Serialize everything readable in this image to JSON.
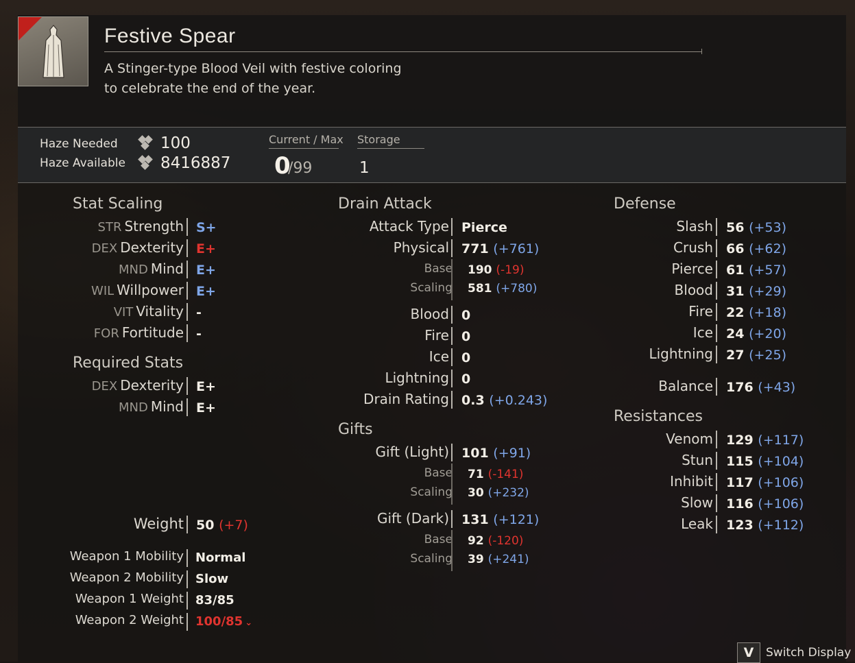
{
  "item": {
    "name": "Festive Spear",
    "description": "A Stinger-type Blood Veil with festive coloring\nto celebrate the end of the year."
  },
  "haze": {
    "needed_label": "Haze Needed",
    "needed_value": "100",
    "available_label": "Haze Available",
    "available_value": "8416887",
    "current_max_label": "Current / Max",
    "current": "0",
    "max": "/99",
    "storage_label": "Storage",
    "storage": "1"
  },
  "stat_scaling": {
    "title": "Stat Scaling",
    "rows": [
      {
        "abbr": "STR",
        "name": "Strength",
        "grade": "S+",
        "color": "#7fa6e8"
      },
      {
        "abbr": "DEX",
        "name": "Dexterity",
        "grade": "E+",
        "color": "#e0342f"
      },
      {
        "abbr": "MND",
        "name": "Mind",
        "grade": "E+",
        "color": "#7fa6e8"
      },
      {
        "abbr": "WIL",
        "name": "Willpower",
        "grade": "E+",
        "color": "#7fa6e8"
      },
      {
        "abbr": "VIT",
        "name": "Vitality",
        "grade": "-",
        "color": "#f2eee6"
      },
      {
        "abbr": "FOR",
        "name": "Fortitude",
        "grade": "-",
        "color": "#f2eee6"
      }
    ]
  },
  "required_stats": {
    "title": "Required Stats",
    "rows": [
      {
        "abbr": "DEX",
        "name": "Dexterity",
        "grade": "E+"
      },
      {
        "abbr": "MND",
        "name": "Mind",
        "grade": "E+"
      }
    ]
  },
  "weight": {
    "label": "Weight",
    "value": "50",
    "delta": "(+7)",
    "w1_mobility_label": "Weapon 1 Mobility",
    "w1_mobility": "Normal",
    "w2_mobility_label": "Weapon 2 Mobility",
    "w2_mobility": "Slow",
    "w1_weight_label": "Weapon 1 Weight",
    "w1_weight": "83/85",
    "w2_weight_label": "Weapon 2 Weight",
    "w2_weight": "100/85"
  },
  "drain_attack": {
    "title": "Drain Attack",
    "attack_type_label": "Attack Type",
    "attack_type": "Pierce",
    "physical_label": "Physical",
    "physical": "771",
    "physical_delta": "(+761)",
    "base_label": "Base",
    "base": "190",
    "base_delta": "(-19)",
    "scaling_label": "Scaling",
    "scaling": "581",
    "scaling_delta": "(+780)",
    "blood_label": "Blood",
    "blood": "0",
    "fire_label": "Fire",
    "fire": "0",
    "ice_label": "Ice",
    "ice": "0",
    "lightning_label": "Lightning",
    "lightning": "0",
    "drain_rating_label": "Drain Rating",
    "drain_rating": "0.3",
    "drain_rating_delta": "(+0.243)"
  },
  "gifts": {
    "title": "Gifts",
    "light_label": "Gift (Light)",
    "light": "101",
    "light_delta": "(+91)",
    "light_base_label": "Base",
    "light_base": "71",
    "light_base_delta": "(-141)",
    "light_scaling_label": "Scaling",
    "light_scaling": "30",
    "light_scaling_delta": "(+232)",
    "dark_label": "Gift (Dark)",
    "dark": "131",
    "dark_delta": "(+121)",
    "dark_base_label": "Base",
    "dark_base": "92",
    "dark_base_delta": "(-120)",
    "dark_scaling_label": "Scaling",
    "dark_scaling": "39",
    "dark_scaling_delta": "(+241)"
  },
  "defense": {
    "title": "Defense",
    "rows": [
      {
        "label": "Slash",
        "value": "56",
        "delta": "(+53)"
      },
      {
        "label": "Crush",
        "value": "66",
        "delta": "(+62)"
      },
      {
        "label": "Pierce",
        "value": "61",
        "delta": "(+57)"
      },
      {
        "label": "Blood",
        "value": "31",
        "delta": "(+29)"
      },
      {
        "label": "Fire",
        "value": "22",
        "delta": "(+18)"
      },
      {
        "label": "Ice",
        "value": "24",
        "delta": "(+20)"
      },
      {
        "label": "Lightning",
        "value": "27",
        "delta": "(+25)"
      }
    ],
    "balance_label": "Balance",
    "balance": "176",
    "balance_delta": "(+43)"
  },
  "resistances": {
    "title": "Resistances",
    "rows": [
      {
        "label": "Venom",
        "value": "129",
        "delta": "(+117)"
      },
      {
        "label": "Stun",
        "value": "115",
        "delta": "(+104)"
      },
      {
        "label": "Inhibit",
        "value": "117",
        "delta": "(+106)"
      },
      {
        "label": "Slow",
        "value": "116",
        "delta": "(+106)"
      },
      {
        "label": "Leak",
        "value": "123",
        "delta": "(+112)"
      }
    ]
  },
  "footer": {
    "key": "V",
    "switch_label": "Switch Display"
  },
  "colors": {
    "positive": "#7fa6e8",
    "negative": "#e0342f",
    "accent": "#c0201c"
  },
  "icons": {
    "item": "blood-veil-icon",
    "haze": "haze-icon",
    "over_weight": "chevron-down-icon"
  }
}
